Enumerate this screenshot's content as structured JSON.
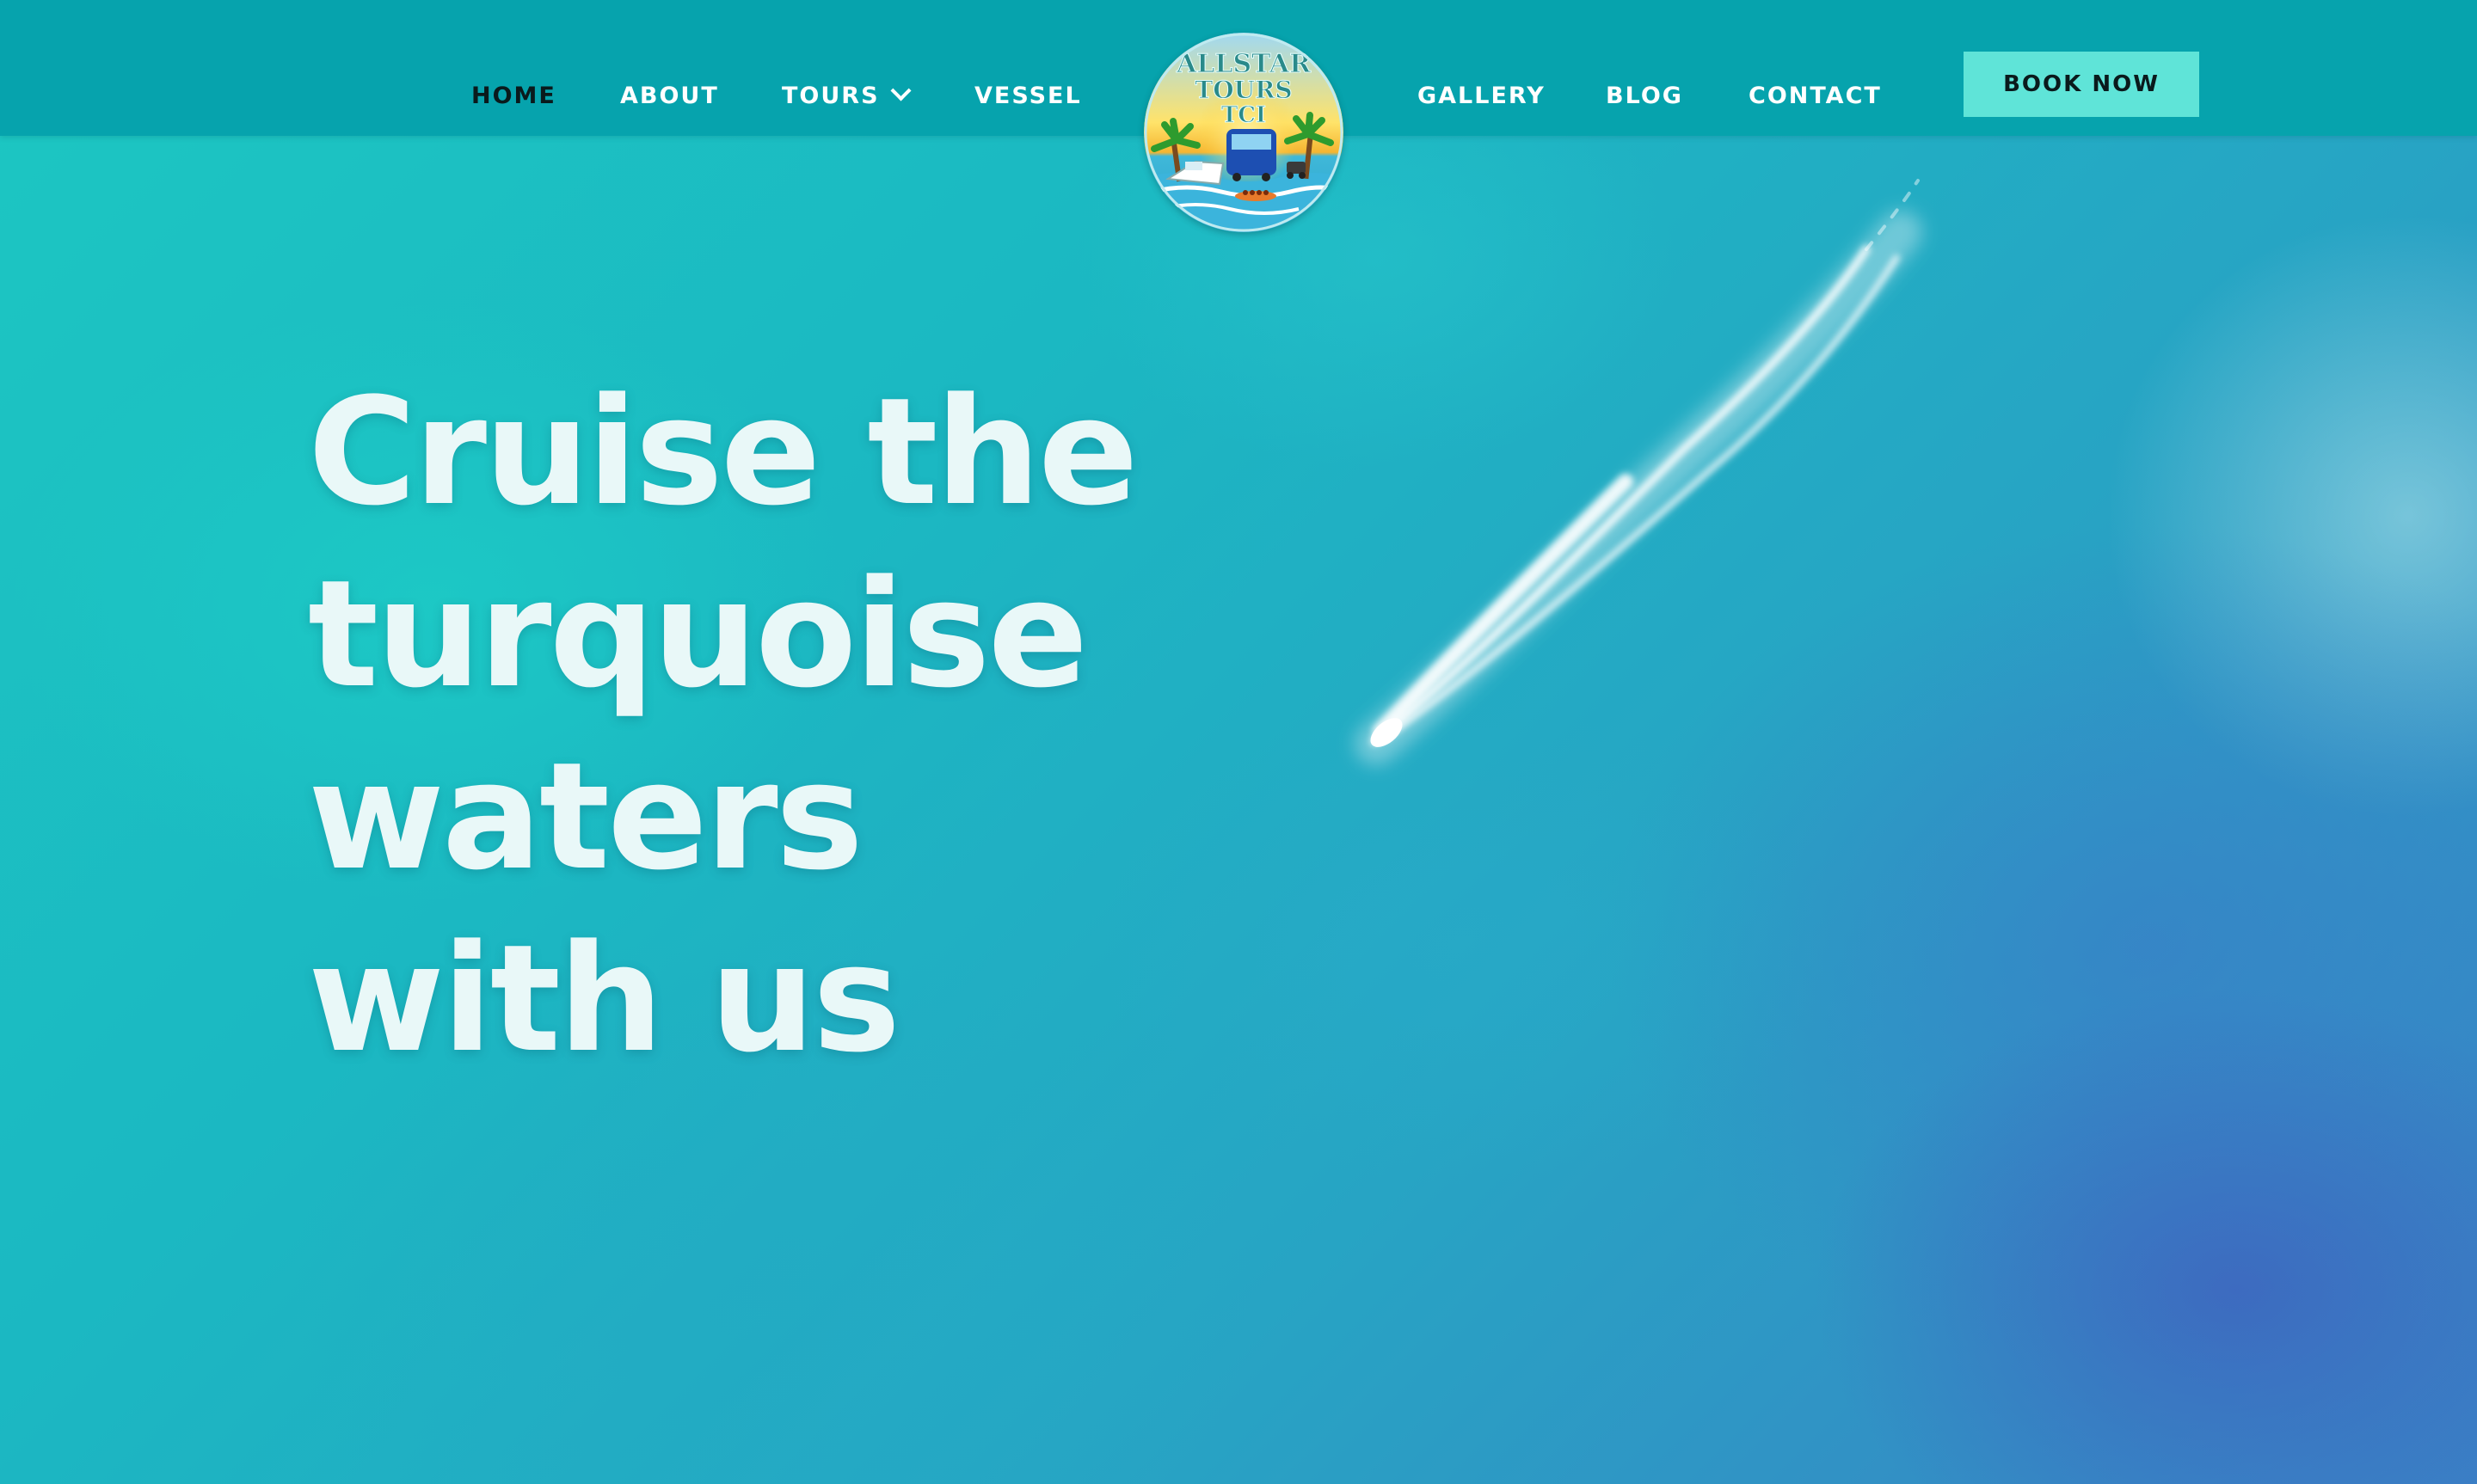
{
  "nav": {
    "left_items": [
      {
        "label": "HOME",
        "active": true
      },
      {
        "label": "ABOUT"
      },
      {
        "label": "TOURS"
      },
      {
        "label": "VESSEL"
      }
    ],
    "right_items": [
      {
        "label": "GALLERY"
      },
      {
        "label": "BLOG"
      },
      {
        "label": "CONTACT"
      }
    ],
    "cta_label": "BOOK NOW"
  },
  "logo": {
    "text_line1": "ALLSTAR",
    "text_line2": "TOURS",
    "text_line3": "TCI"
  },
  "hero": {
    "headline_lines": [
      "Cruise the",
      "turquoise",
      "waters",
      "with us"
    ]
  },
  "colors": {
    "header_bg": "#06a3ad",
    "cta_bg": "#5fe4d8",
    "active_nav": "#0a1a1c",
    "headline": "#e9f8f8"
  },
  "icons": {
    "dropdown": "chevron-down-icon"
  }
}
